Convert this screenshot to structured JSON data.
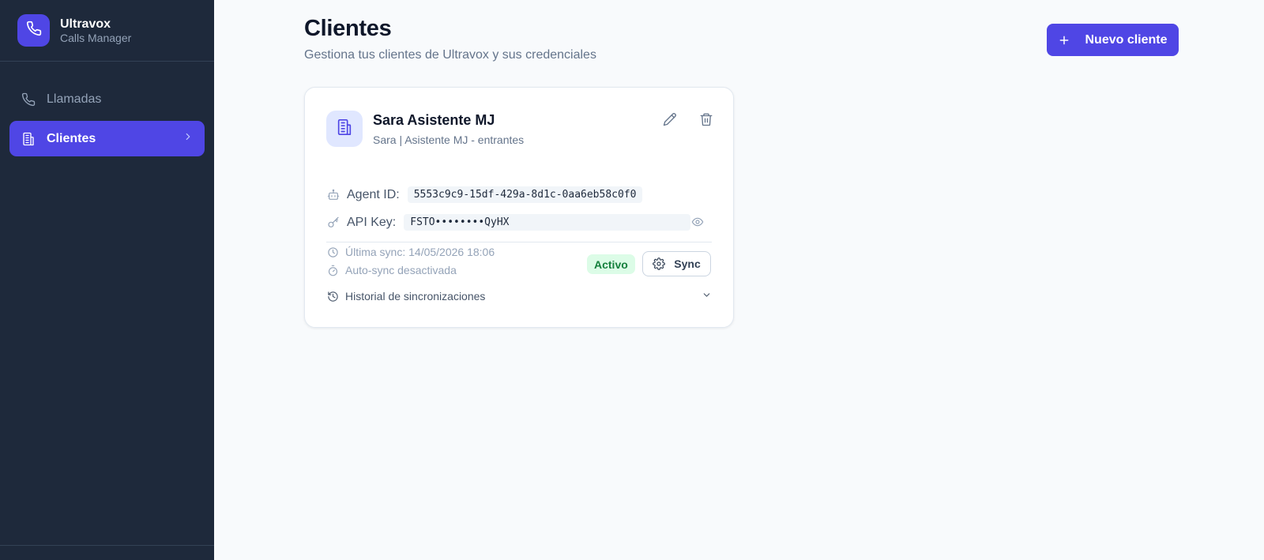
{
  "brand": {
    "title": "Ultravox",
    "subtitle": "Calls Manager",
    "icon": "phone-icon",
    "accent": "#4f46e5"
  },
  "sidebar": {
    "items": [
      {
        "label": "Llamadas",
        "icon": "phone-icon",
        "active": false
      },
      {
        "label": "Clientes",
        "icon": "building-icon",
        "active": true
      }
    ]
  },
  "page": {
    "title": "Clientes",
    "subtitle": "Gestiona tus clientes de Ultravox y sus credenciales",
    "new_button_label": "Nuevo cliente"
  },
  "client_card": {
    "name": "Sara Asistente MJ",
    "description": "Sara | Asistente MJ - entrantes",
    "agent_id_label": "Agent ID:",
    "agent_id": "5553c9c9-15df-429a-8d1c-0aa6eb58c0f0",
    "api_key_label": "API Key:",
    "api_key": "FSTO••••••••QyHX",
    "last_sync": "Última sync: 14/05/2026 18:06",
    "auto_sync": "Auto-sync desactivada",
    "status": "Activo",
    "sync_button_label": "Sync",
    "history_label": "Historial de sincronizaciones"
  },
  "colors": {
    "sidebar_bg": "#1e293b",
    "primary": "#4f46e5",
    "status_active_bg": "#dcfce7",
    "status_active_text": "#15803d"
  }
}
